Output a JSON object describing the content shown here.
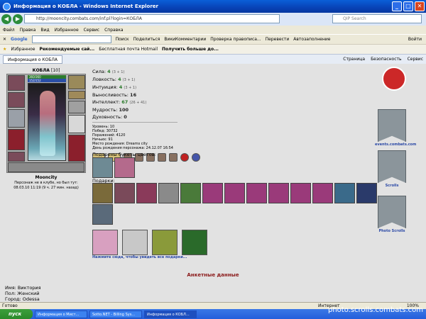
{
  "window": {
    "title": "Информация о КОБЛА - Windows Internet Explorer"
  },
  "address": {
    "url": "http://mooncity.combats.com/inf.pl?login=КОБЛА",
    "search_placeholder": "QIP Search"
  },
  "menu": [
    "Файл",
    "Правка",
    "Вид",
    "Избранное",
    "Сервис",
    "Справка"
  ],
  "google_bar": {
    "logo": "Google",
    "search_label": "Поиск",
    "share": "Поделиться",
    "wiki": "ВикиКомментарии",
    "spell": "Проверка правописа...",
    "translate": "Перевести",
    "autofill": "Автозаполнение",
    "signin": "Войти"
  },
  "favorites": {
    "label": "Избранное",
    "items": [
      "Рекомендуемые сай...",
      "Бесплатная почта Hotmail",
      "Получить больше до..."
    ]
  },
  "tab": {
    "label": "Информация о КОБЛА"
  },
  "commands": [
    "Страница",
    "Безопасность",
    "Сервис"
  ],
  "character": {
    "name": "КОБЛА",
    "level": "[10]",
    "hp": "360/360",
    "mp": "152/152",
    "city": "Mooncity",
    "note": "Персонаж не в клубе, но был тут:",
    "last_seen": "08.03.10 11:19 (9 ч. 27 мин. назад)"
  },
  "stats": [
    {
      "label": "Сила:",
      "value": "4",
      "bonus": "(3 + 1)"
    },
    {
      "label": "Ловкость:",
      "value": "4",
      "bonus": "(3 + 1)"
    },
    {
      "label": "Интуиция:",
      "value": "4",
      "bonus": "(3 + 1)"
    },
    {
      "label": "Выносливость:",
      "value": "16",
      "bonus": ""
    },
    {
      "label": "Интеллект:",
      "value": "67",
      "bonus": "(26 + 41)"
    },
    {
      "label": "Мудрость:",
      "value": "100",
      "bonus": ""
    },
    {
      "label": "Духовность:",
      "value": "0",
      "bonus": ""
    }
  ],
  "info": {
    "level": "Уровень: 10",
    "wins": "Побед: 30732",
    "losses": "Поражений: 4120",
    "draws": "Ничьих: 91",
    "birthplace": "Место рождения: Dreams city",
    "birthday": "День рождения персонажа: 24.12.07 16:54"
  },
  "bouquets_title": "Подарены букеты цветов:",
  "gifts_title": "Подарки:",
  "gifts_link": "Нажмите сюда, чтобы увидеть все подарки...",
  "anketa": {
    "title": "Анкетные данные",
    "name": "Имя: Виктория",
    "gender": "Пол: Женский",
    "city": "Город: Odessa"
  },
  "side_links": [
    "events.combats.com",
    "Scrolls",
    "Photo Scrolls"
  ],
  "status": {
    "left": "Готово",
    "zone": "Интернет",
    "zoom": "100%"
  },
  "taskbar": {
    "start": "пуск",
    "tasks": [
      "Информация о Мист...",
      "Sotto.NET - Billing Sys...",
      "Информация о КОБЛ..."
    ]
  },
  "watermark": "photo.scrolls.combats.com",
  "colors": {
    "title_blue": "#0a5fd8",
    "anketa_red": "#8b1a1a",
    "link_blue": "#2a48a6",
    "stat_green": "#2c7a2c"
  }
}
